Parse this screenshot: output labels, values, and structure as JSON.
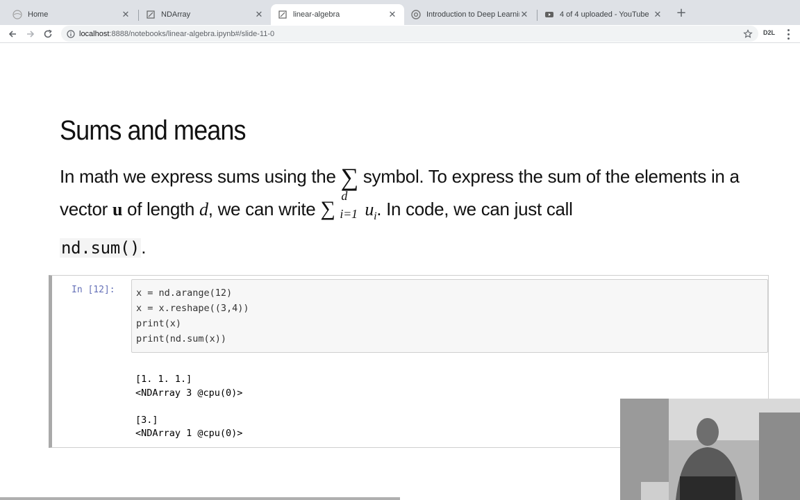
{
  "browser": {
    "tabs": [
      {
        "title": "Home",
        "icon": "jupyter-icon",
        "active": false
      },
      {
        "title": "NDArray",
        "icon": "jupyter-icon",
        "active": false
      },
      {
        "title": "linear-algebra",
        "icon": "jupyter-icon",
        "active": true
      },
      {
        "title": "Introduction to Deep Learning",
        "icon": "chrome-icon",
        "active": false
      },
      {
        "title": "4 of 4 uploaded - YouTube",
        "icon": "youtube-icon",
        "active": false
      }
    ],
    "url_host": "localhost",
    "url_rest": ":8888/notebooks/linear-algebra.ipynb#/slide-11-0",
    "extension_label": "D2L"
  },
  "slide": {
    "title": "Sums and means",
    "para_1": "In math we express sums using the",
    "sigma": "∑",
    "para_2": " symbol. To express the sum of the elements in a vector ",
    "vec": "u",
    "para_3": " of length ",
    "d": "d",
    "para_4": ", we can write ",
    "sum_sup": "d",
    "sum_sub": "i=1",
    "sum_term": "u",
    "sum_term_sub": "i",
    "para_5": ". In code, we can just call ",
    "code": "nd.sum()",
    "para_6": "."
  },
  "cell": {
    "prompt": "In [12]:",
    "code_lines": [
      "x = nd.arange(12)",
      "x = x.reshape((3,4))",
      "print(x)",
      "print(nd.sum(x))"
    ],
    "output_lines": [
      "[1. 1. 1.]",
      "<NDArray 3 @cpu(0)>",
      "",
      "[3.]",
      "<NDArray 1 @cpu(0)>"
    ]
  },
  "webcam": {
    "description_icon": "presenter-video-icon"
  }
}
